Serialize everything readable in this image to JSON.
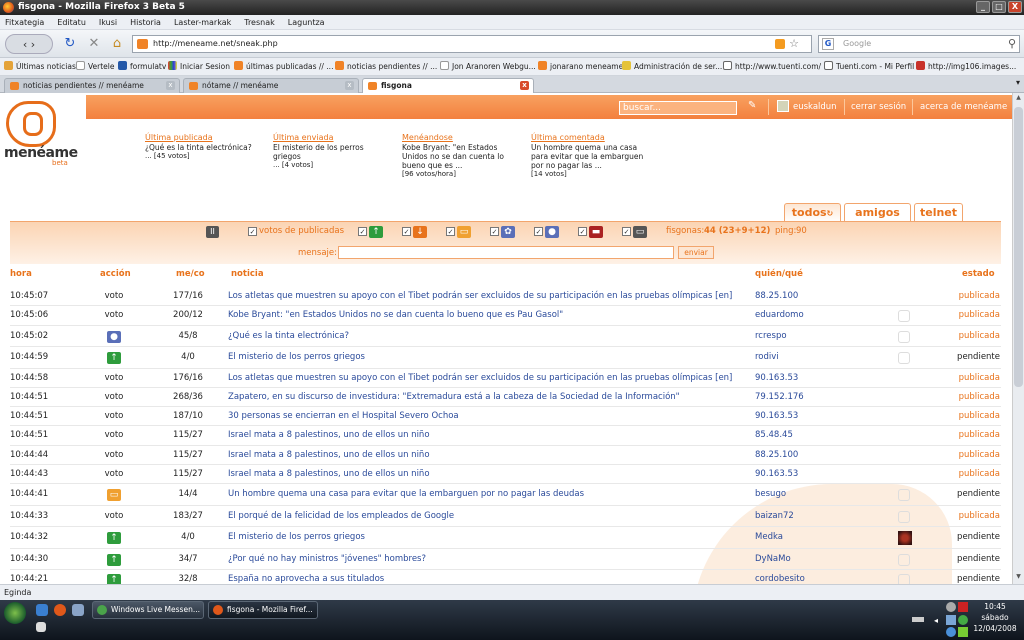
{
  "window": {
    "title": "fisgona - Mozilla Firefox 3 Beta 5",
    "min": "_",
    "max": "□",
    "close": "X"
  },
  "menu": [
    "Fitxategia",
    "Editatu",
    "Ikusi",
    "Historia",
    "Laster-markak",
    "Tresnak",
    "Laguntza"
  ],
  "nav": {
    "back": "‹ ›",
    "reload": "↻",
    "stop": "✕",
    "home": "⌂",
    "url": "http://meneame.net/sneak.php",
    "search_engine": "G",
    "search_placeholder": "Google"
  },
  "bookmarks": [
    "Últimas noticias",
    "Vertele",
    "formulatv",
    "Iniciar Sesion",
    "últimas publicadas // ...",
    "noticias pendientes // ...",
    "Jon Aranoren Webgu...",
    "jonarano meneame",
    "Administración de ser...",
    "http://www.tuenti.com/",
    "Tuenti.com - Mi Perfil",
    "http://img106.images..."
  ],
  "tabs": [
    {
      "label": "noticias pendientes // menéame",
      "close": "x"
    },
    {
      "label": "nótame // menéame",
      "close": "x"
    },
    {
      "label": "fisgona",
      "close": "x"
    }
  ],
  "site": {
    "search_placeholder": "buscar...",
    "search_icon": "✎",
    "user": "euskaldun",
    "logout": "cerrar sesión",
    "about": "acerca de menéame",
    "logo_text": "menéame",
    "logo_beta": "beta"
  },
  "summary": [
    {
      "heading": "Última publicada",
      "text": "¿Qué es la tinta electrónica?",
      "votes": "... [45 votos]"
    },
    {
      "heading": "Última enviada",
      "text": "El misterio de los perros griegos",
      "votes": "... [4 votos]"
    },
    {
      "heading": "Menéandose",
      "text": "Kobe Bryant: \"en Estados Unidos no se dan cuenta lo bueno que es ...",
      "votes": "[96 votos/hora]"
    },
    {
      "heading": "Última comentada",
      "text": "Un hombre quema una casa para evitar que la embarguen por no pagar las ...",
      "votes": "[14 votos]"
    }
  ],
  "viewtabs": [
    "todos",
    "amigos",
    "telnet"
  ],
  "controls": {
    "pause": "II",
    "check": "✓",
    "votes_label": "votos de publicadas",
    "fisgonas_label": "fisgonas:",
    "fisgonas_value": "44 (23+9+12)",
    "ping_label": "ping:",
    "ping_value": "90",
    "message_label": "mensaje:",
    "send": "enviar",
    "filter_icons": [
      {
        "name": "up-arrow-icon",
        "glyph": "↑",
        "color": "#2e9c3c"
      },
      {
        "name": "down-arrow-icon",
        "glyph": "↓",
        "color": "#e8731c"
      },
      {
        "name": "comment-icon",
        "glyph": "▭",
        "color": "#f0a030"
      },
      {
        "name": "flower-icon",
        "glyph": "✿",
        "color": "#5a6fb8"
      },
      {
        "name": "user-icon",
        "glyph": "●",
        "color": "#5a6fb8"
      },
      {
        "name": "chat-icon",
        "glyph": "▬",
        "color": "#a22"
      },
      {
        "name": "post-icon",
        "glyph": "▭",
        "color": "#555"
      }
    ]
  },
  "table": {
    "headers": {
      "time": "hora",
      "action": "acción",
      "meco": "me/co",
      "news": "noticia",
      "who": "quién/qué",
      "status": "estado"
    },
    "rows": [
      {
        "time": "10:45:07",
        "action": "voto",
        "icon": "",
        "meco": "177/16",
        "title": "Los atletas que muestren su apoyo con el Tibet podrán ser excluidos de su participación en las pruebas olímpicas [en]",
        "who": "88.25.100",
        "ghost": false,
        "avatar": false,
        "status": "publicada"
      },
      {
        "time": "10:45:06",
        "action": "voto",
        "icon": "",
        "meco": "200/12",
        "title": "Kobe Bryant: \"en Estados Unidos no se dan cuenta lo bueno que es Pau Gasol\"",
        "who": "eduardomo",
        "ghost": true,
        "avatar": false,
        "status": "publicada"
      },
      {
        "time": "10:45:02",
        "action": "",
        "icon": "user",
        "meco": "45/8",
        "title": "¿Qué es la tinta electrónica?",
        "who": "rcrespo",
        "ghost": true,
        "avatar": false,
        "status": "publicada"
      },
      {
        "time": "10:44:59",
        "action": "",
        "icon": "up",
        "meco": "4/0",
        "title": "El misterio de los perros griegos",
        "who": "rodivi",
        "ghost": true,
        "avatar": false,
        "status": "pendiente"
      },
      {
        "time": "10:44:58",
        "action": "voto",
        "icon": "",
        "meco": "176/16",
        "title": "Los atletas que muestren su apoyo con el Tibet podrán ser excluidos de su participación en las pruebas olímpicas [en]",
        "who": "90.163.53",
        "ghost": false,
        "avatar": false,
        "status": "publicada"
      },
      {
        "time": "10:44:51",
        "action": "voto",
        "icon": "",
        "meco": "268/36",
        "title": "Zapatero, en su discurso de investidura: \"Extremadura está a la cabeza de la Sociedad de la Información\"",
        "who": "79.152.176",
        "ghost": false,
        "avatar": false,
        "status": "publicada"
      },
      {
        "time": "10:44:51",
        "action": "voto",
        "icon": "",
        "meco": "187/10",
        "title": "30 personas se encierran en el Hospital Severo Ochoa",
        "who": "90.163.53",
        "ghost": false,
        "avatar": false,
        "status": "publicada"
      },
      {
        "time": "10:44:51",
        "action": "voto",
        "icon": "",
        "meco": "115/27",
        "title": "Israel mata a 8 palestinos, uno de ellos un niño",
        "who": "85.48.45",
        "ghost": false,
        "avatar": false,
        "status": "publicada"
      },
      {
        "time": "10:44:44",
        "action": "voto",
        "icon": "",
        "meco": "115/27",
        "title": "Israel mata a 8 palestinos, uno de ellos un niño",
        "who": "88.25.100",
        "ghost": false,
        "avatar": false,
        "status": "publicada"
      },
      {
        "time": "10:44:43",
        "action": "voto",
        "icon": "",
        "meco": "115/27",
        "title": "Israel mata a 8 palestinos, uno de ellos un niño",
        "who": "90.163.53",
        "ghost": false,
        "avatar": false,
        "status": "publicada"
      },
      {
        "time": "10:44:41",
        "action": "",
        "icon": "comment",
        "meco": "14/4",
        "title": "Un hombre quema una casa para evitar que la embarguen por no pagar las deudas",
        "who": "besugo",
        "ghost": true,
        "avatar": false,
        "status": "pendiente"
      },
      {
        "time": "10:44:33",
        "action": "voto",
        "icon": "",
        "meco": "183/27",
        "title": "El porqué de la felicidad de los empleados de Google",
        "who": "baizan72",
        "ghost": true,
        "avatar": false,
        "status": "publicada"
      },
      {
        "time": "10:44:32",
        "action": "",
        "icon": "up",
        "meco": "4/0",
        "title": "El misterio de los perros griegos",
        "who": "Medka",
        "ghost": false,
        "avatar": true,
        "status": "pendiente"
      },
      {
        "time": "10:44:30",
        "action": "",
        "icon": "up",
        "meco": "34/7",
        "title": "¿Por qué no hay ministros \"jóvenes\" hombres?",
        "who": "DyNaMo",
        "ghost": true,
        "avatar": false,
        "status": "pendiente"
      },
      {
        "time": "10:44:21",
        "action": "",
        "icon": "up",
        "meco": "32/8",
        "title": "España no aprovecha a sus titulados",
        "who": "cordobesito",
        "ghost": true,
        "avatar": false,
        "status": "pendiente"
      }
    ]
  },
  "statusbar": "Egindа",
  "taskbar": {
    "tasks": [
      "Windows Live Messen...",
      "fisgona - Mozilla Firef..."
    ],
    "time": "10:45",
    "day": "sábado",
    "date": "12/04/2008"
  },
  "colors": {
    "accent": "#e8731c",
    "link": "#2a4a9a",
    "green": "#2e9c3c"
  }
}
